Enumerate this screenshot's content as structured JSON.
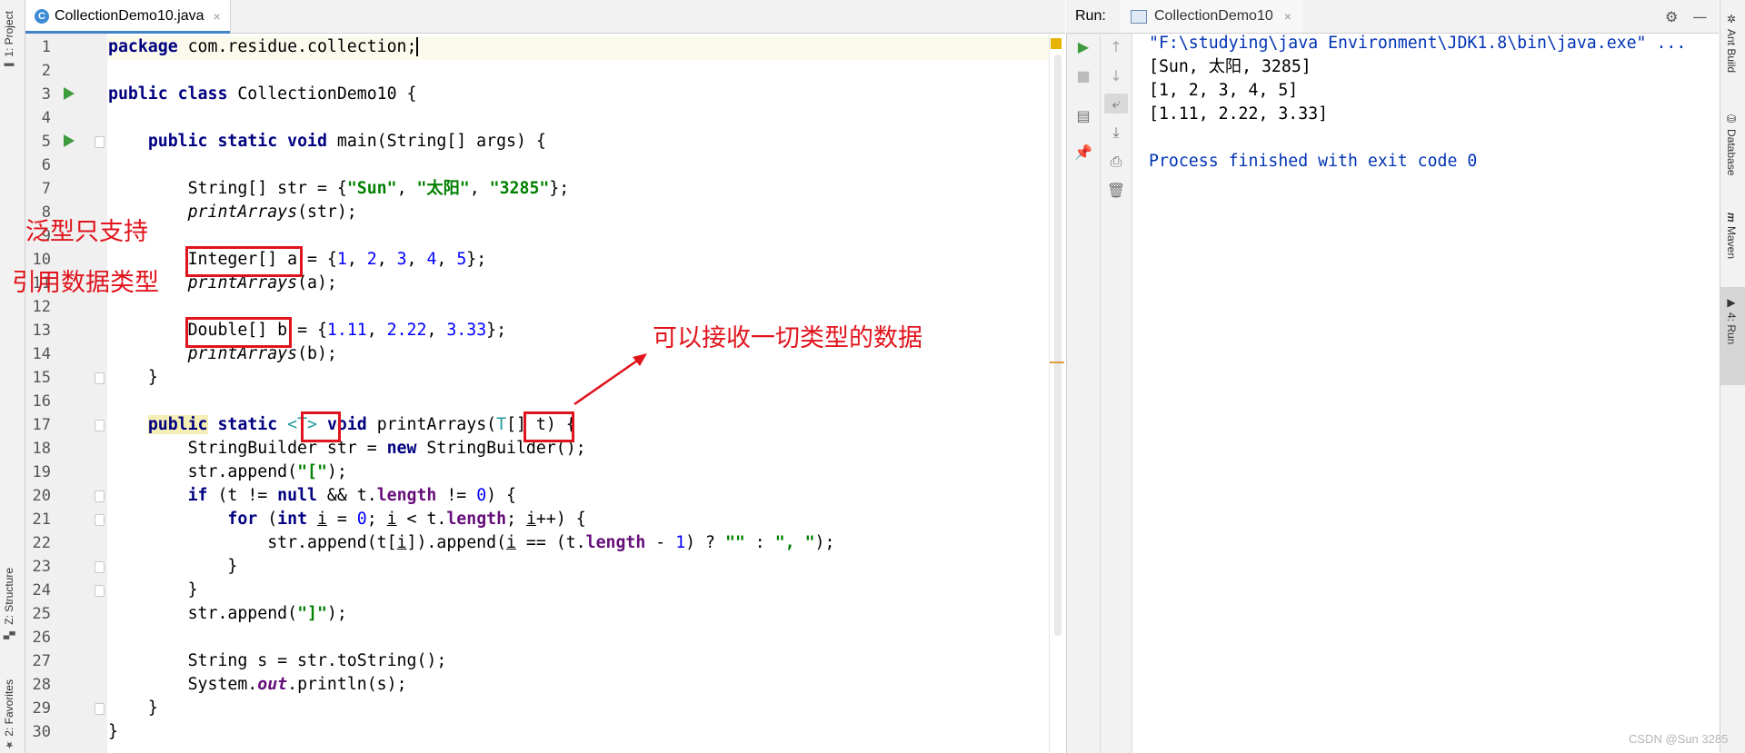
{
  "left_tool_window_tabs": [
    {
      "label": "1: Project",
      "icon": "folder-icon"
    },
    {
      "label": "Z: Structure",
      "icon": "structure-icon"
    },
    {
      "label": "2: Favorites",
      "icon": "star-icon"
    }
  ],
  "editor": {
    "tab_title": "CollectionDemo10.java",
    "tab_icon": "java-class-icon",
    "line_numbers": [
      "1",
      "2",
      "3",
      "4",
      "5",
      "6",
      "7",
      "8",
      "9",
      "10",
      "11",
      "12",
      "13",
      "14",
      "15",
      "16",
      "17",
      "18",
      "19",
      "20",
      "21",
      "22",
      "23",
      "24",
      "25",
      "26",
      "27",
      "28",
      "29",
      "30"
    ],
    "code": {
      "l1_kw": "package",
      "l1_rest": " com.residue.collection;",
      "l3_kw1": "public",
      "l3_kw2": "class",
      "l3_rest": " CollectionDemo10 {",
      "l5_kw1": "public",
      "l5_kw2": "static",
      "l5_kw3": "void",
      "l5_rest": " main(String[] args) {",
      "l7_a": "String[] str = {",
      "l7_s1": "\"Sun\"",
      "l7_s2": "\"太阳\"",
      "l7_s3": "\"3285\"",
      "l7_end": "};",
      "l8_call": "printArrays",
      "l8_rest": "(str);",
      "l10_a": "Integer[]",
      "l10_b": " a = {",
      "l10_end": "};",
      "l11_call": "printArrays",
      "l11_rest": "(a);",
      "l13_a": "Double[]",
      "l13_b": " b = {",
      "l13_end": "};",
      "l14_call": "printArrays",
      "l14_rest": "(b);",
      "l15": "}",
      "l17_kw1": "public",
      "l17_kw2": "static",
      "l17_tp": "<T>",
      "l17_kw3": "void",
      "l17_name": " printArrays(",
      "l17_tp2": "T",
      "l17_rest": "[] t) {",
      "l18_a": "StringBuilder str = ",
      "l18_kw": "new",
      "l18_b": " StringBuilder();",
      "l19_a": "str.append(",
      "l19_s": "\"[\"",
      "l19_b": ");",
      "l20_kw1": "if",
      "l20_a": " (t != ",
      "l20_kw2": "null",
      "l20_b": " && t.",
      "l20_f": "length",
      "l20_c": " != ",
      "l20_n": "0",
      "l20_d": ") {",
      "l21_kw1": "for",
      "l21_a": " (",
      "l21_kw2": "int",
      "l21_v1": "i",
      "l21_b": " = ",
      "l21_n": "0",
      "l21_c": "; ",
      "l21_v2": "i",
      "l21_d": " < t.",
      "l21_f": "length",
      "l21_e": "; ",
      "l21_v3": "i",
      "l21_g": "++) {",
      "l22_a": "str.append(t[",
      "l22_v1": "i",
      "l22_b": "]).append(",
      "l22_v2": "i",
      "l22_c": " == (t.",
      "l22_f": "length",
      "l22_d": " - ",
      "l22_n": "1",
      "l22_e": ") ? ",
      "l22_s1": "\"\"",
      "l22_g": " : ",
      "l22_s2": "\", \"",
      "l22_h": ");",
      "l23": "}",
      "l24": "}",
      "l25_a": "str.append(",
      "l25_s": "\"]\"",
      "l25_b": ");",
      "l27": "String s = str.toString();",
      "l28_a": "System.",
      "l28_f": "out",
      "l28_b": ".println(s);",
      "l29": "}",
      "l30": "}"
    },
    "integers": [
      "1",
      "2",
      "3",
      "4",
      "5"
    ],
    "doubles": [
      "1.11",
      "2.22",
      "3.33"
    ]
  },
  "annotations": {
    "left_note_line1": "泛型只支持",
    "left_note_line2": "引用数据类型",
    "right_note": "可以接收一切类型的数据",
    "color": "#e0141c"
  },
  "run_panel": {
    "label": "Run:",
    "tab_title": "CollectionDemo10",
    "toolbar_icons": [
      "rerun-icon",
      "stop-icon",
      "layout-icon",
      "pin-icon",
      "up-arrow-icon",
      "down-arrow-icon",
      "soft-wrap-icon",
      "scroll-to-end-icon",
      "print-icon",
      "trash-icon"
    ],
    "console": [
      "\"F:\\studying\\java Environment\\JDK1.8\\bin\\java.exe\" ...",
      "[Sun, 太阳, 3285]",
      "[1, 2, 3, 4, 5]",
      "[1.11, 2.22, 3.33]",
      "",
      "Process finished with exit code 0"
    ]
  },
  "right_tool_window_tabs": [
    {
      "label": "Ant Build",
      "icon": "ant-icon"
    },
    {
      "label": "Database",
      "icon": "database-icon"
    },
    {
      "label": "Maven",
      "icon": "maven-icon"
    },
    {
      "label": "4: Run",
      "icon": "run-icon"
    }
  ],
  "watermark": "CSDN @Sun 3285"
}
